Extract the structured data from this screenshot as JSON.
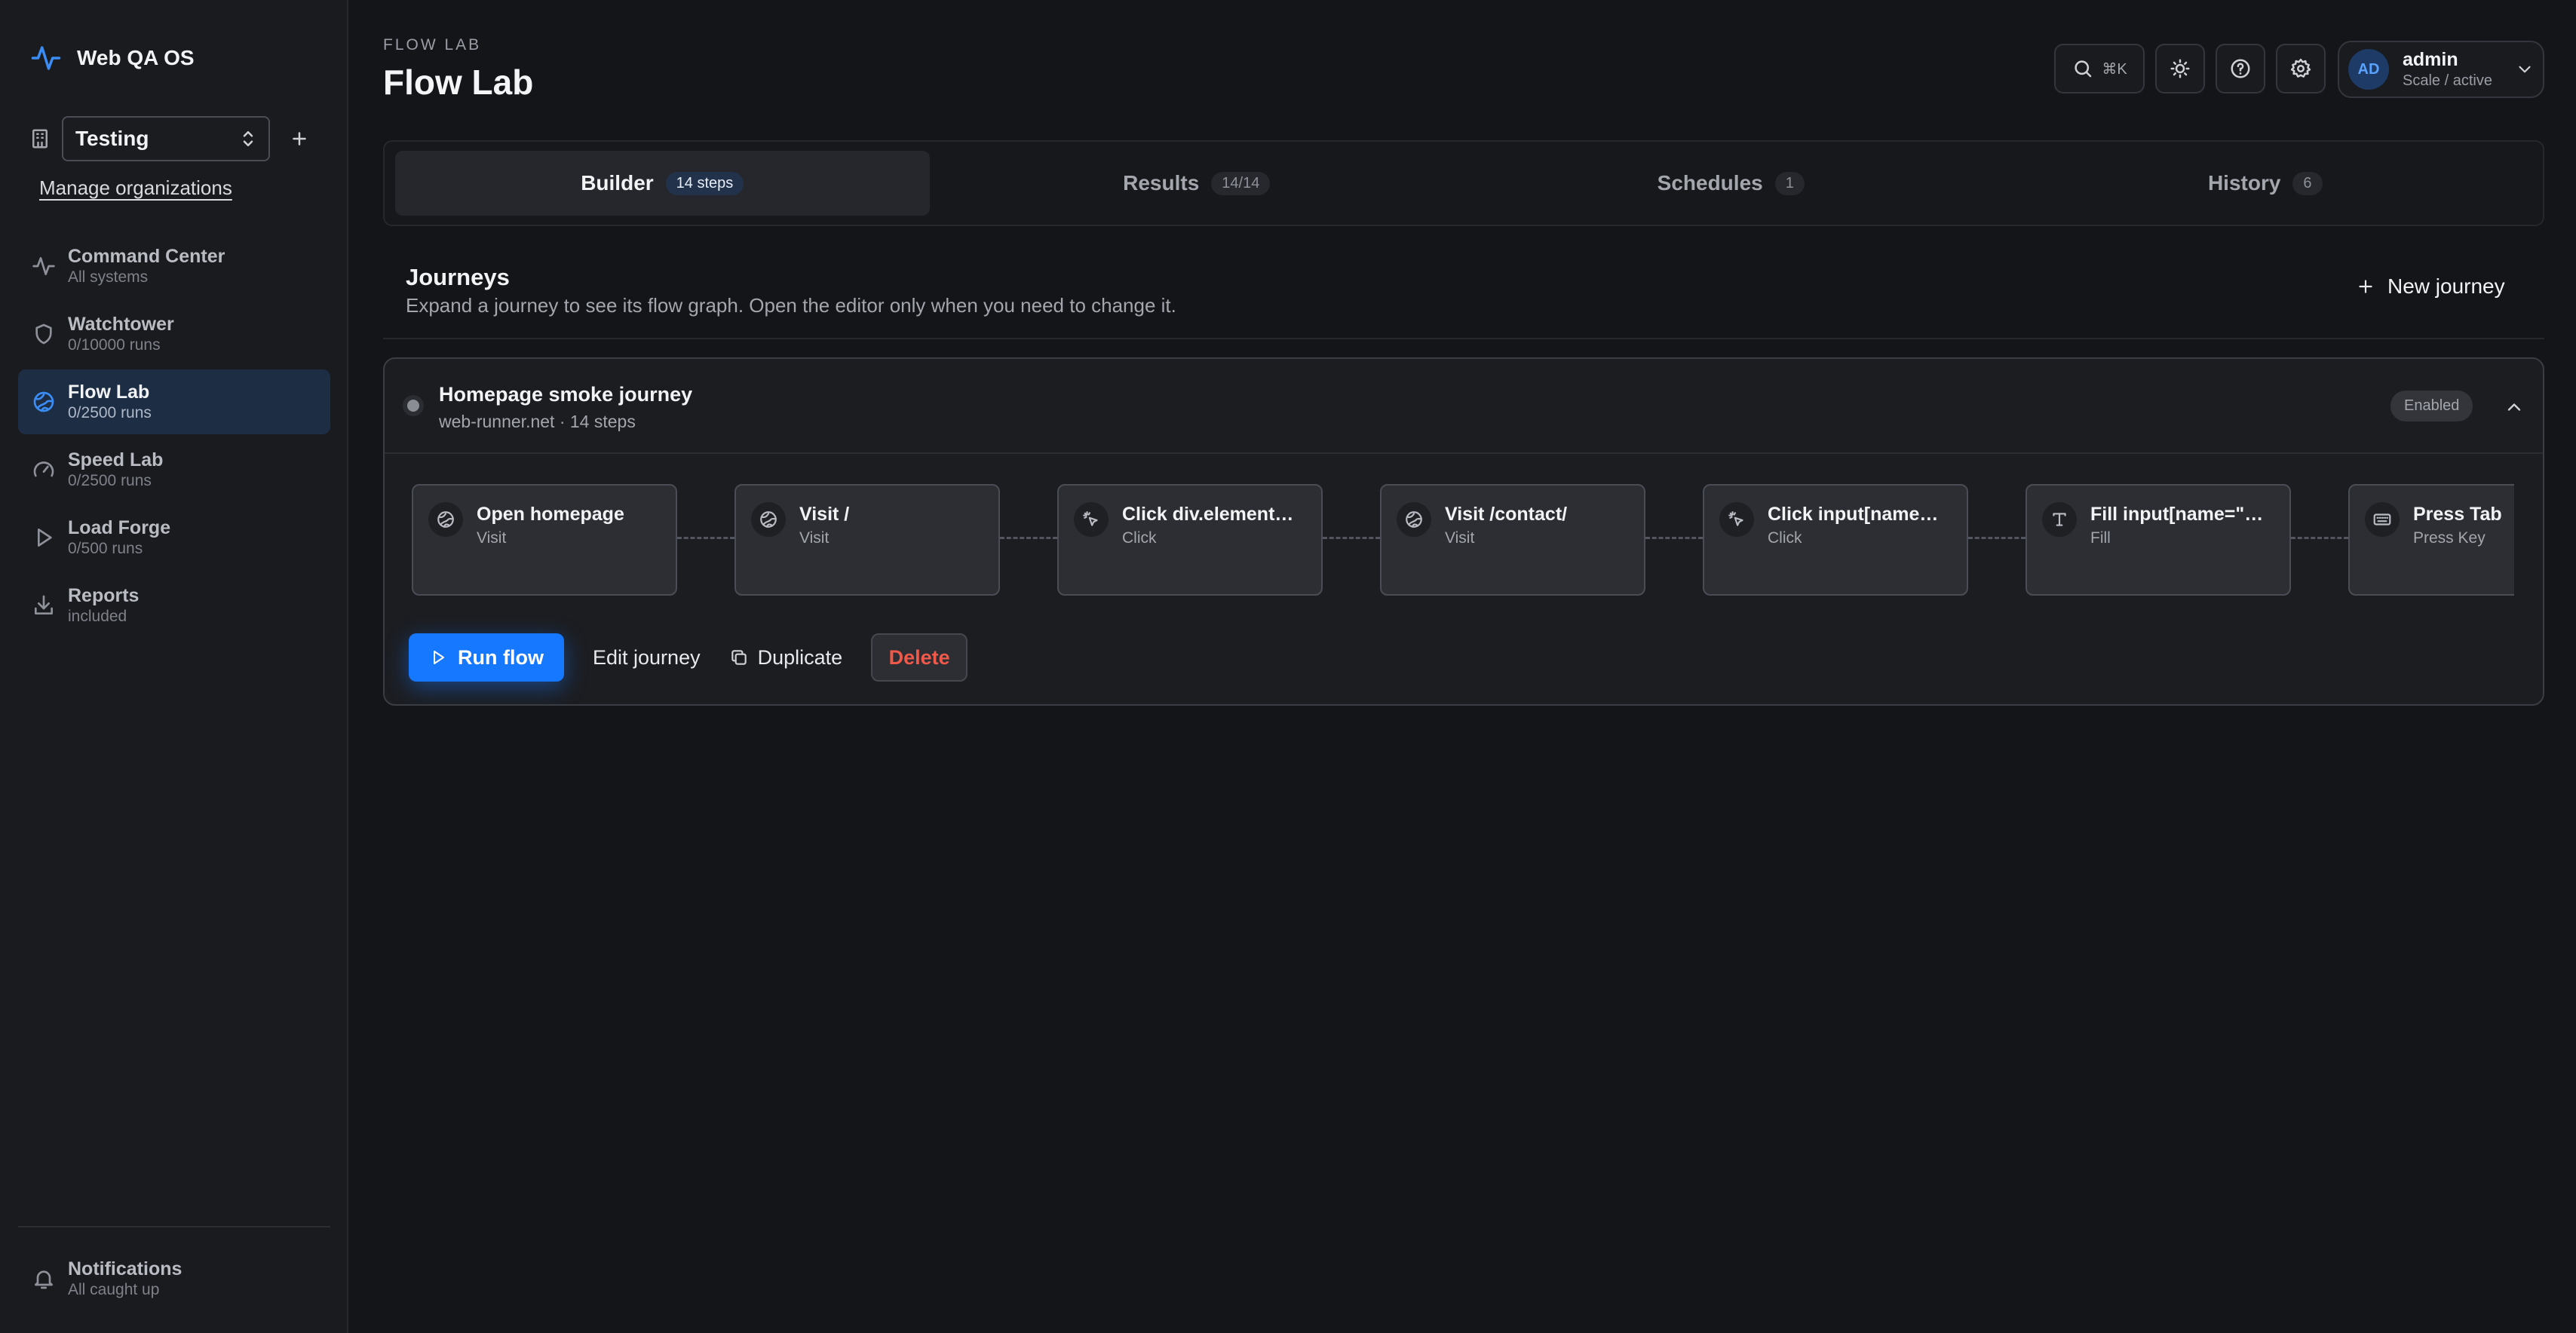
{
  "app": {
    "name": "Web QA OS"
  },
  "org": {
    "selected": "Testing",
    "manage_label": "Manage organizations"
  },
  "nav": [
    {
      "title": "Command Center",
      "sub": "All systems",
      "icon": "activity-icon"
    },
    {
      "title": "Watchtower",
      "sub": "0/10000 runs",
      "icon": "shield-icon"
    },
    {
      "title": "Flow Lab",
      "sub": "0/2500 runs",
      "icon": "globe-icon",
      "active": true
    },
    {
      "title": "Speed Lab",
      "sub": "0/2500 runs",
      "icon": "gauge-icon"
    },
    {
      "title": "Load Forge",
      "sub": "0/500 runs",
      "icon": "play-icon"
    },
    {
      "title": "Reports",
      "sub": "included",
      "icon": "download-icon"
    }
  ],
  "notifications": {
    "title": "Notifications",
    "sub": "All caught up"
  },
  "header": {
    "eyebrow": "FLOW LAB",
    "title": "Flow Lab",
    "search_shortcut": "⌘K",
    "user": {
      "initials": "AD",
      "name": "admin",
      "sub": "Scale / active"
    }
  },
  "tabs": [
    {
      "label": "Builder",
      "badge": "14 steps",
      "active": true
    },
    {
      "label": "Results",
      "badge": "14/14"
    },
    {
      "label": "Schedules",
      "badge": "1"
    },
    {
      "label": "History",
      "badge": "6"
    }
  ],
  "journeys": {
    "title": "Journeys",
    "description": "Expand a journey to see its flow graph. Open the editor only when you need to change it.",
    "new_label": "New journey"
  },
  "journey": {
    "title": "Homepage smoke journey",
    "subtitle": "web-runner.net · 14 steps",
    "status": "Enabled",
    "steps": [
      {
        "title": "Open homepage",
        "type": "Visit",
        "icon": "globe-icon"
      },
      {
        "title": "Visit /",
        "type": "Visit",
        "icon": "globe-icon"
      },
      {
        "title": "Click div.element…",
        "type": "Click",
        "icon": "pointer-click-icon"
      },
      {
        "title": "Visit /contact/",
        "type": "Visit",
        "icon": "globe-icon"
      },
      {
        "title": "Click input[name…",
        "type": "Click",
        "icon": "pointer-click-icon"
      },
      {
        "title": "Fill input[name=\"…",
        "type": "Fill",
        "icon": "type-icon"
      },
      {
        "title": "Press Tab",
        "type": "Press Key",
        "icon": "keyboard-icon"
      }
    ],
    "actions": {
      "run": "Run flow",
      "edit": "Edit journey",
      "duplicate": "Duplicate",
      "delete": "Delete"
    }
  },
  "colors": {
    "accent": "#1677ff",
    "danger": "#f0584a",
    "background": "#141518",
    "sidebar": "#1a1b1f"
  }
}
